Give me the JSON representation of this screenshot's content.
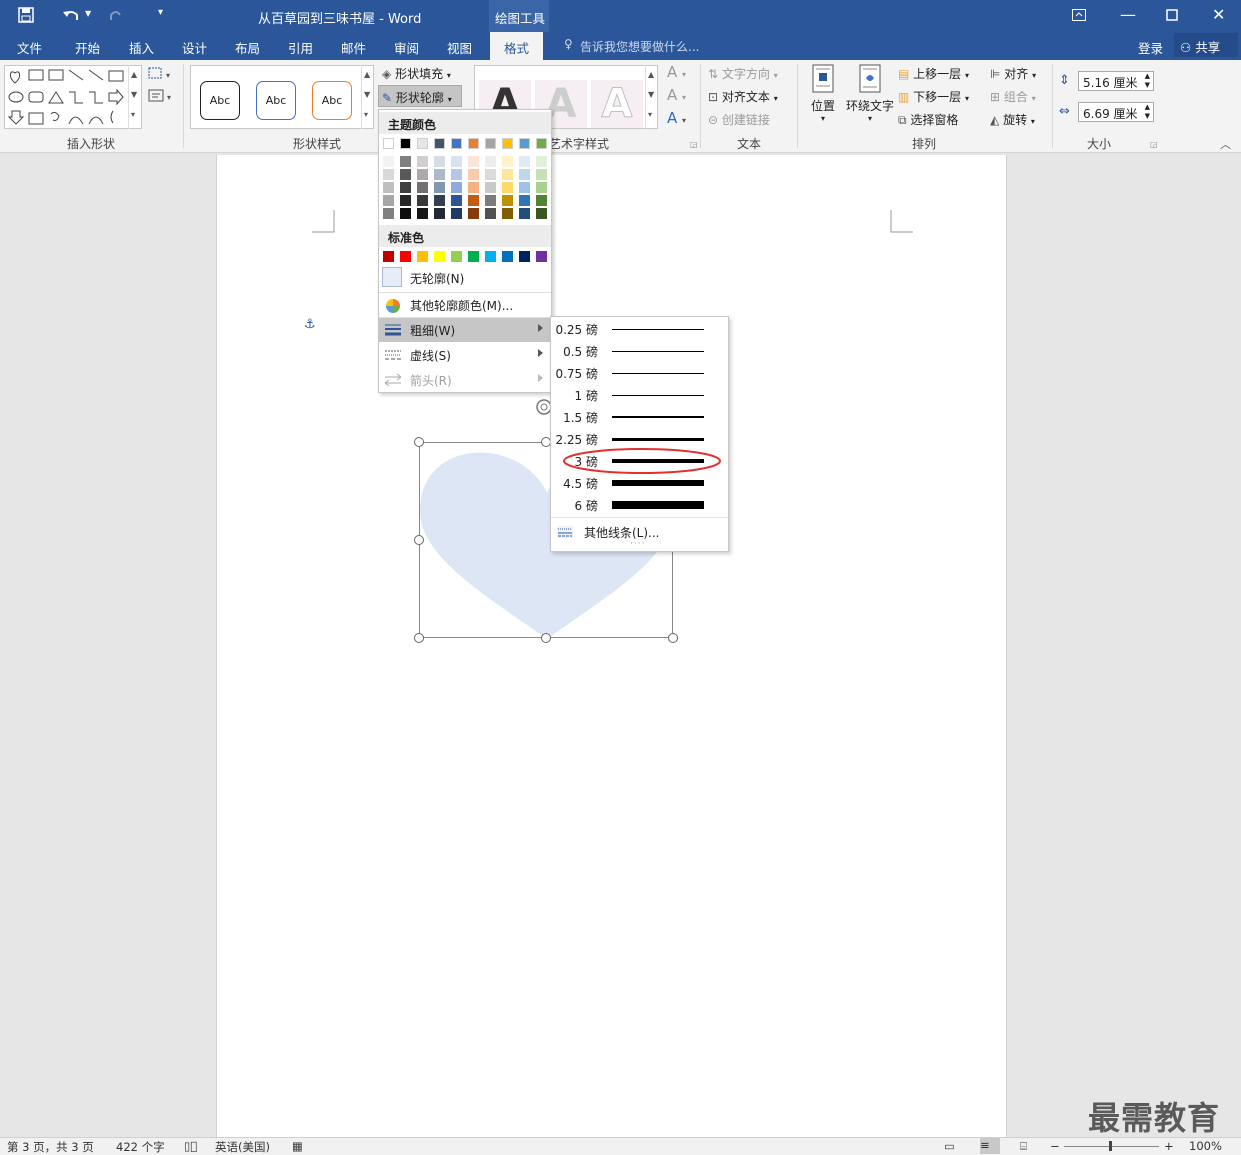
{
  "titlebar": {
    "doc_title": "从百草园到三味书屋 - Word",
    "context_tab": "绘图工具"
  },
  "tabs": [
    "文件",
    "开始",
    "插入",
    "设计",
    "布局",
    "引用",
    "邮件",
    "审阅",
    "视图",
    "格式"
  ],
  "active_tab": "格式",
  "tell_me": "告诉我您想要做什么...",
  "login": "登录",
  "share": "共享",
  "ribbon": {
    "groups": {
      "insert_shape": "插入形状",
      "shape_style": "形状样式",
      "art_style": "艺术字样式",
      "text": "文本",
      "arrange": "排列",
      "size": "大小"
    },
    "shape_fill": "形状填充",
    "shape_outline": "形状轮廓",
    "abc_samples": [
      "Abc",
      "Abc",
      "Abc"
    ],
    "art_sample": "A",
    "text_direction": "文字方向",
    "align_text": "对齐文本",
    "create_link": "创建链接",
    "position": "位置",
    "wrap_text": "环绕文字",
    "bring_forward": "上移一层",
    "send_backward": "下移一层",
    "selection_pane": "选择窗格",
    "align": "对齐",
    "group": "组合",
    "rotate": "旋转",
    "height": "5.16 厘米",
    "width": "6.69 厘米"
  },
  "outline_menu": {
    "theme_colors": "主题颜色",
    "standard_colors": "标准色",
    "no_outline": "无轮廓(N)",
    "more_colors": "其他轮廓颜色(M)...",
    "weight": "粗细(W)",
    "dashes": "虚线(S)",
    "arrows": "箭头(R)"
  },
  "theme_palette": {
    "top": [
      "#ffffff",
      "#000000",
      "#e7e6e6",
      "#44546a",
      "#4472c4",
      "#ed7d31",
      "#a5a5a5",
      "#ffc000",
      "#5b9bd5",
      "#70ad47"
    ],
    "shades": [
      [
        "#f2f2f2",
        "#d9d9d9",
        "#bfbfbf",
        "#a6a6a6",
        "#808080"
      ],
      [
        "#808080",
        "#595959",
        "#404040",
        "#262626",
        "#0d0d0d"
      ],
      [
        "#d0cece",
        "#aeaaaa",
        "#757070",
        "#3b3838",
        "#171616"
      ],
      [
        "#d6dce5",
        "#adb9ca",
        "#8497b0",
        "#333f50",
        "#222a35"
      ],
      [
        "#d9e2f3",
        "#b4c7e7",
        "#8faadc",
        "#2f5597",
        "#203864"
      ],
      [
        "#fbe5d6",
        "#f8cbad",
        "#f4b183",
        "#c55a11",
        "#843c0c"
      ],
      [
        "#ededed",
        "#dbdbdb",
        "#c9c9c9",
        "#7b7b7b",
        "#525252"
      ],
      [
        "#fff2cc",
        "#ffe699",
        "#ffd966",
        "#bf9000",
        "#7f6000"
      ],
      [
        "#deebf7",
        "#bdd7ee",
        "#9dc3e6",
        "#2e75b6",
        "#1f4e79"
      ],
      [
        "#e2f0d9",
        "#c5e0b4",
        "#a9d18e",
        "#548235",
        "#385723"
      ]
    ]
  },
  "standard_palette": [
    "#c00000",
    "#ff0000",
    "#ffc000",
    "#ffff00",
    "#92d050",
    "#00b050",
    "#00b0f0",
    "#0070c0",
    "#002060",
    "#7030a0"
  ],
  "weight_menu": {
    "items": [
      {
        "label": "0.25 磅",
        "pt": 0.25
      },
      {
        "label": "0.5 磅",
        "pt": 0.5
      },
      {
        "label": "0.75 磅",
        "pt": 0.75
      },
      {
        "label": "1 磅",
        "pt": 1
      },
      {
        "label": "1.5 磅",
        "pt": 1.5
      },
      {
        "label": "2.25 磅",
        "pt": 2.25
      },
      {
        "label": "3 磅",
        "pt": 3
      },
      {
        "label": "4.5 磅",
        "pt": 4.5
      },
      {
        "label": "6 磅",
        "pt": 6
      }
    ],
    "highlighted": "3 磅",
    "more_lines": "其他线条(L)..."
  },
  "status": {
    "page": "第 3 页，共 3 页",
    "words": "422 个字",
    "language": "英语(美国)",
    "zoom": "100%"
  },
  "watermark": "最需教育",
  "colors": {
    "accent": "#2b579a",
    "heart_fill": "#dce6f4",
    "highlight_ring": "#e03030"
  }
}
